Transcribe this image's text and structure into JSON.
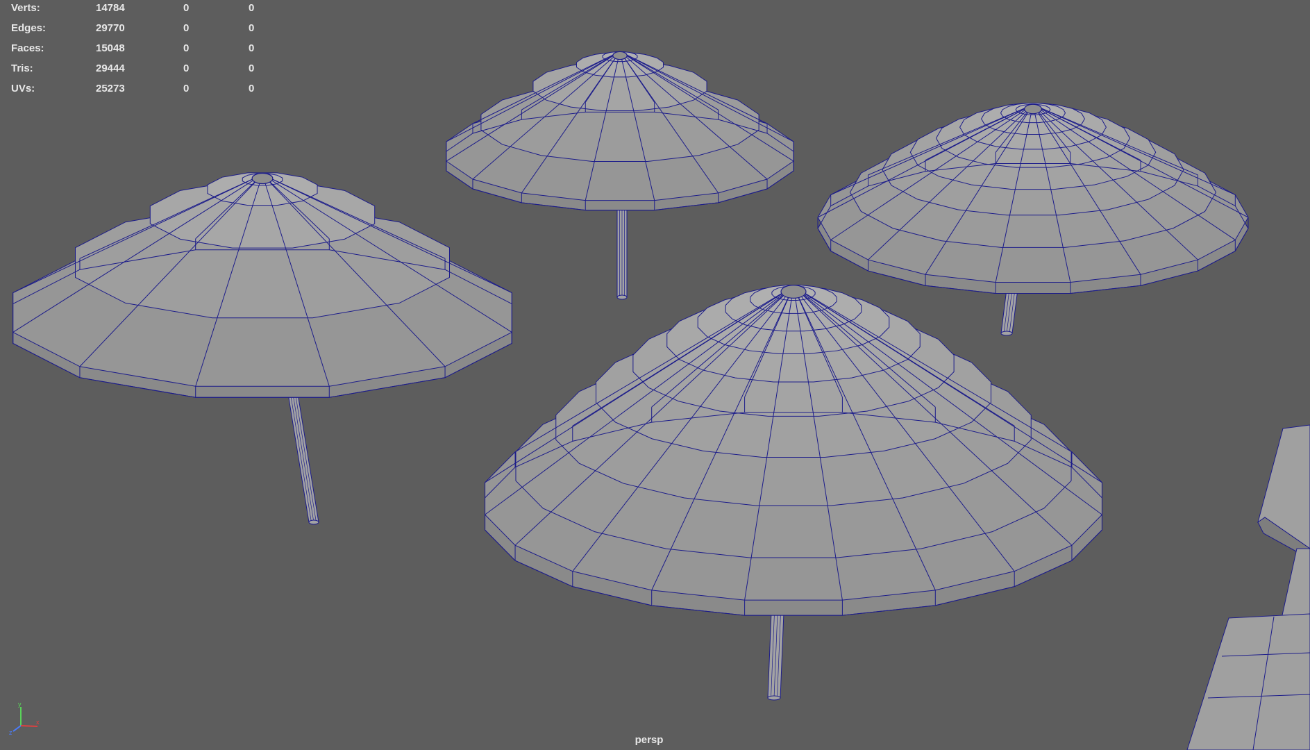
{
  "stats": [
    {
      "label": "Verts:",
      "values": [
        "14784",
        "0",
        "0"
      ]
    },
    {
      "label": "Edges:",
      "values": [
        "29770",
        "0",
        "0"
      ]
    },
    {
      "label": "Faces:",
      "values": [
        "15048",
        "0",
        "0"
      ]
    },
    {
      "label": "Tris:",
      "values": [
        "29444",
        "0",
        "0"
      ]
    },
    {
      "label": "UVs:",
      "values": [
        "25273",
        "0",
        "0"
      ]
    }
  ],
  "camera": "persp",
  "colors": {
    "background": "#5d5d5d",
    "wire": "#1c1c8a",
    "surface": "#a3a3a3",
    "rim": "#8a8a8a",
    "hud_text": "#e8e8e8"
  },
  "icons": [
    "axis-gizmo-icon"
  ]
}
